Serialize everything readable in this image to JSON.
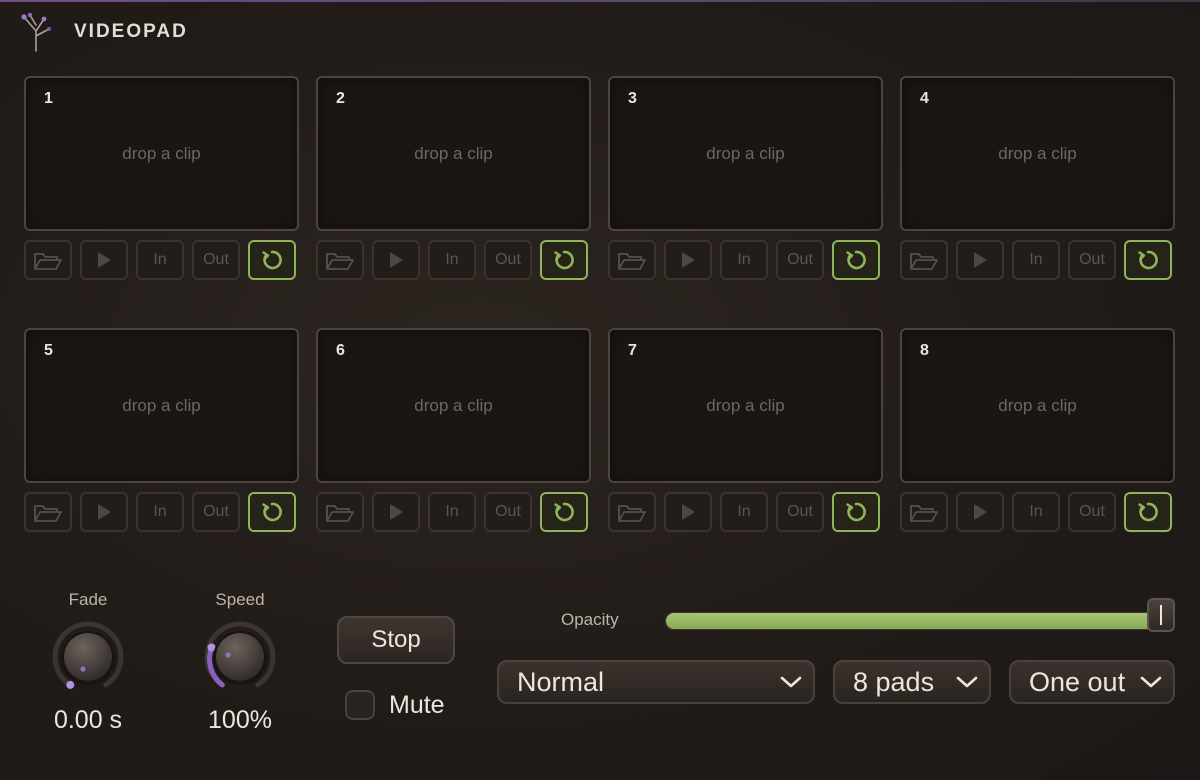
{
  "app": {
    "title": "VIDEOPAD"
  },
  "pads": [
    {
      "number": "1",
      "placeholder": "drop a clip",
      "in_label": "In",
      "out_label": "Out"
    },
    {
      "number": "2",
      "placeholder": "drop a clip",
      "in_label": "In",
      "out_label": "Out"
    },
    {
      "number": "3",
      "placeholder": "drop a clip",
      "in_label": "In",
      "out_label": "Out"
    },
    {
      "number": "4",
      "placeholder": "drop a clip",
      "in_label": "In",
      "out_label": "Out"
    },
    {
      "number": "5",
      "placeholder": "drop a clip",
      "in_label": "In",
      "out_label": "Out"
    },
    {
      "number": "6",
      "placeholder": "drop a clip",
      "in_label": "In",
      "out_label": "Out"
    },
    {
      "number": "7",
      "placeholder": "drop a clip",
      "in_label": "In",
      "out_label": "Out"
    },
    {
      "number": "8",
      "placeholder": "drop a clip",
      "in_label": "In",
      "out_label": "Out"
    }
  ],
  "pad_icons": [
    "folder-icon",
    "play-icon",
    "loop-icon"
  ],
  "controls": {
    "fade": {
      "label": "Fade",
      "value": "0.00 s",
      "level": 0
    },
    "speed": {
      "label": "Speed",
      "value": "100%",
      "level": 0.5
    },
    "stop_label": "Stop",
    "mute": {
      "label": "Mute",
      "checked": false
    },
    "opacity": {
      "label": "Opacity",
      "value": 1.0
    },
    "blend_mode": {
      "selected": "Normal"
    },
    "pad_count": {
      "selected": "8 pads"
    },
    "output_mode": {
      "selected": "One out"
    }
  },
  "colors": {
    "accent_green": "#8fb55b",
    "knob_purple": "#8a5fc0",
    "background": "#221c19"
  }
}
